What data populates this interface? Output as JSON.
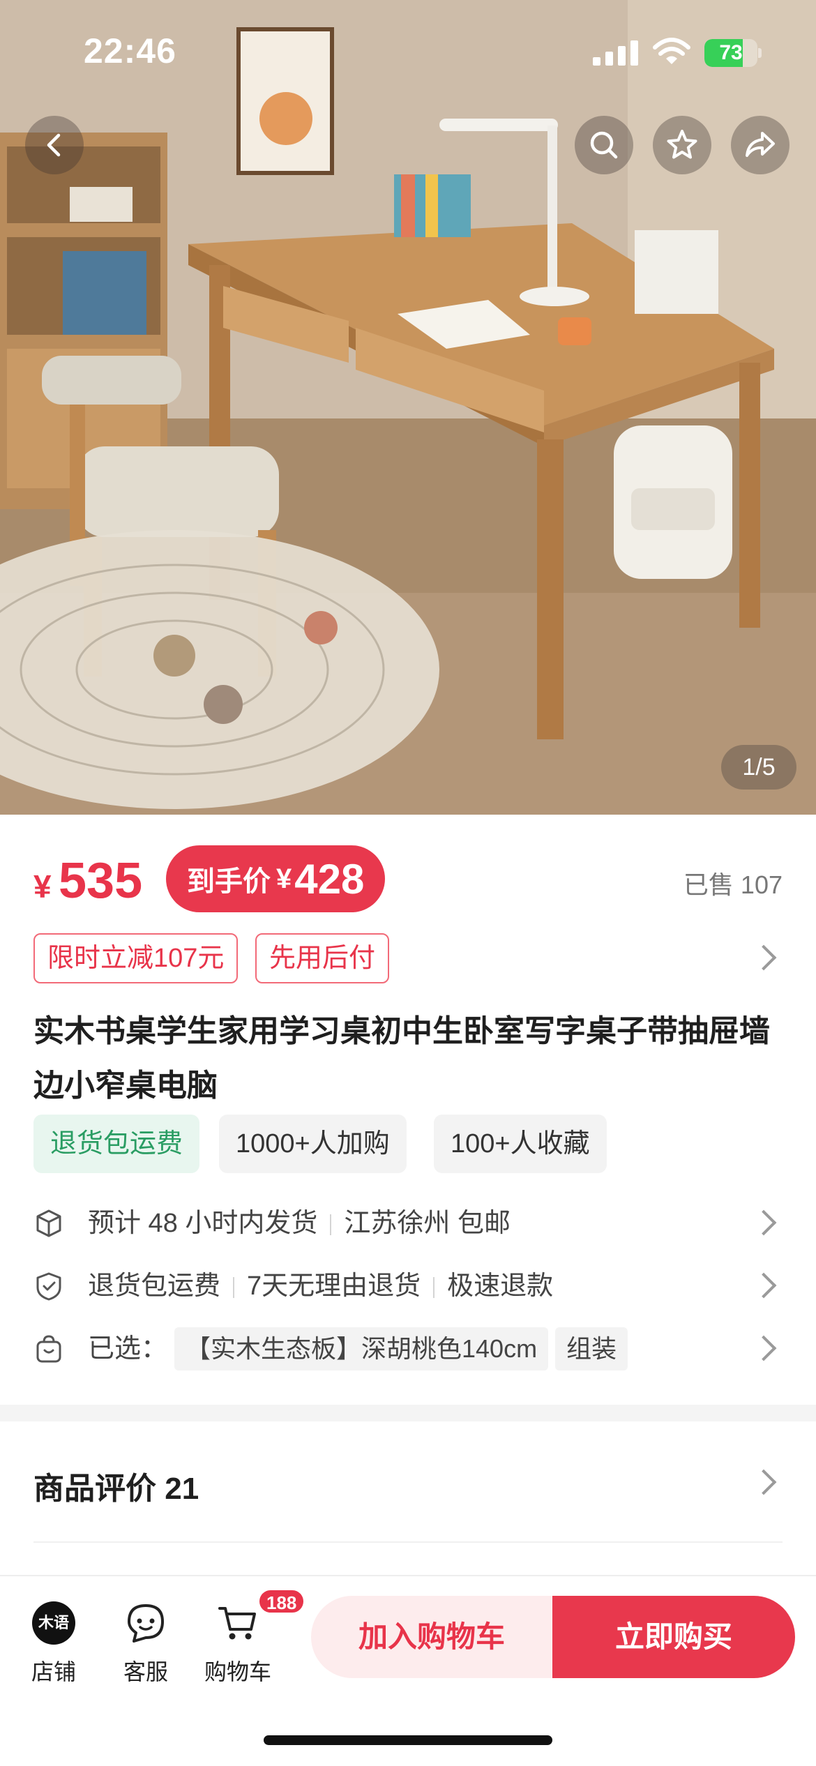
{
  "status_bar": {
    "time": "22:46",
    "battery": "73",
    "battery_level": 0.73,
    "icons": [
      "cellular-signal-icon",
      "wifi-icon",
      "battery-charging-icon"
    ]
  },
  "hero": {
    "page_indicator": "1/5",
    "current_image": 1,
    "total_images": 5,
    "nav_icons": [
      "back-icon",
      "search-icon",
      "star-icon",
      "share-icon"
    ]
  },
  "price": {
    "symbol": "¥",
    "value": "535",
    "final_label": "到手价",
    "final_symbol": "¥",
    "final_value": "428",
    "sold": "已售 107"
  },
  "promos": [
    "限时立减107元",
    "先用后付"
  ],
  "title": "实木书桌学生家用学习桌初中生卧室写字桌子带抽屉墙边小窄桌电脑",
  "feature_tags": [
    "退货包运费",
    "1000+人加购",
    "100+人收藏"
  ],
  "shipping": {
    "eta": "预计 48 小时内发货",
    "origin": "江苏徐州 包邮"
  },
  "guarantee": {
    "items": [
      "退货包运费",
      "7天无理由退货",
      "极速退款"
    ]
  },
  "selection": {
    "label": "已选：",
    "options": [
      "【实木生态板】深胡桃色140cm",
      "组装"
    ]
  },
  "reviews": {
    "label": "商品评价 21"
  },
  "bottom_bar": {
    "store_logo": "木语",
    "store_label": "店铺",
    "service_label": "客服",
    "cart_label": "购物车",
    "cart_badge": "188",
    "add_to_cart": "加入购物车",
    "buy_now": "立即购买"
  },
  "colors": {
    "accent_red": "#e8384d",
    "green_tag": "#2a9d63",
    "battery_green": "#37d058"
  }
}
